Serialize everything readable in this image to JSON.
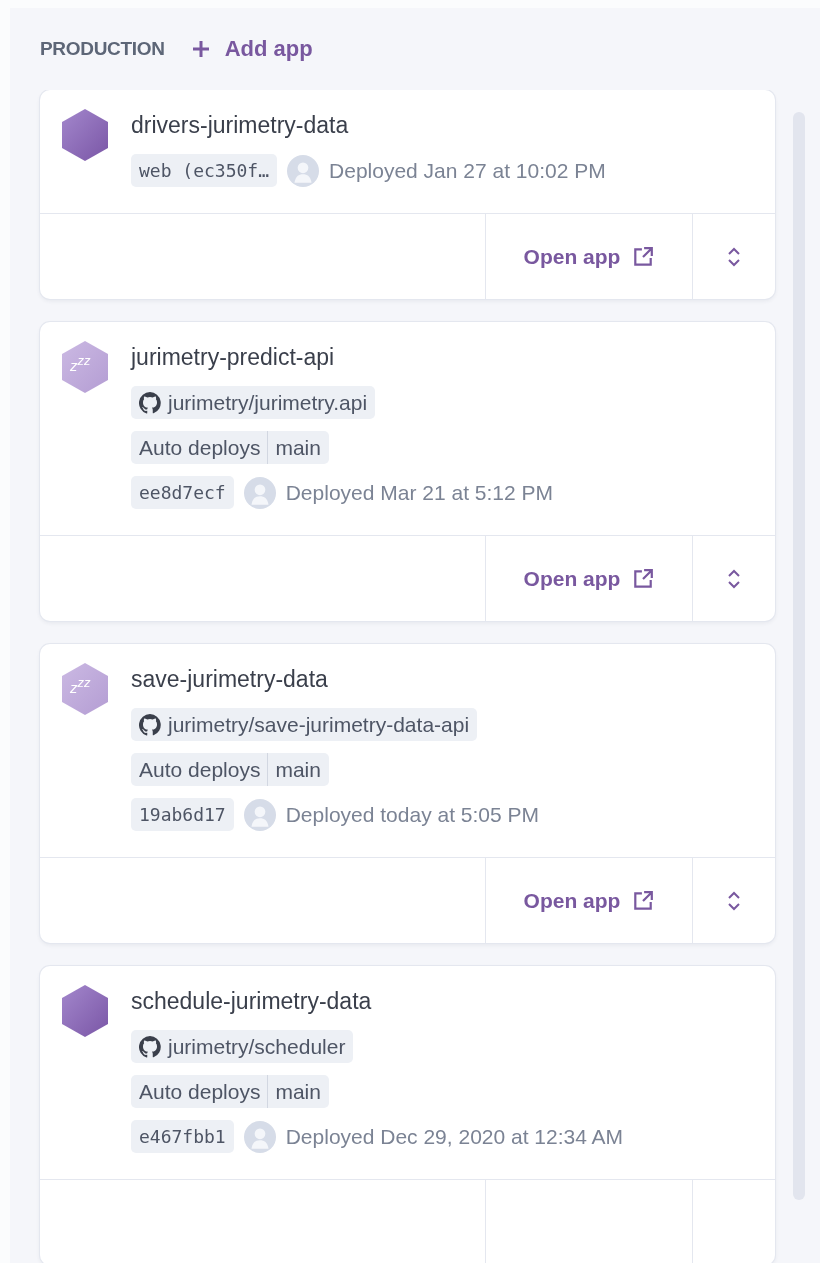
{
  "header": {
    "section": "PRODUCTION",
    "add_label": "Add app"
  },
  "apps": [
    {
      "name": "drivers-jurimetry-data",
      "sleeping": false,
      "commit": "web (ec350f…",
      "deployed": "Deployed Jan 27 at 10:02 PM",
      "open_label": "Open app",
      "actions_shown": true
    },
    {
      "name": "jurimetry-predict-api",
      "sleeping": true,
      "sleep_mark": "z$^{z}$$^{z}$",
      "repo": "jurimetry/jurimetry.api",
      "auto_deploy": {
        "label": "Auto deploys",
        "branch": "main"
      },
      "commit": "ee8d7ecf",
      "deployed": "Deployed Mar 21 at 5:12 PM",
      "open_label": "Open app",
      "actions_shown": true
    },
    {
      "name": "save-jurimetry-data",
      "sleeping": true,
      "sleep_mark": "z$^{z}$$^{z}$",
      "repo": "jurimetry/save-jurimetry-data-api",
      "auto_deploy": {
        "label": "Auto deploys",
        "branch": "main"
      },
      "commit": "19ab6d17",
      "deployed": "Deployed today at 5:05 PM",
      "open_label": "Open app",
      "actions_shown": true
    },
    {
      "name": "schedule-jurimetry-data",
      "sleeping": false,
      "repo": "jurimetry/scheduler",
      "auto_deploy": {
        "label": "Auto deploys",
        "branch": "main"
      },
      "commit": "e467fbb1",
      "deployed": "Deployed Dec 29, 2020 at 12:34 AM",
      "actions_shown": false
    }
  ]
}
